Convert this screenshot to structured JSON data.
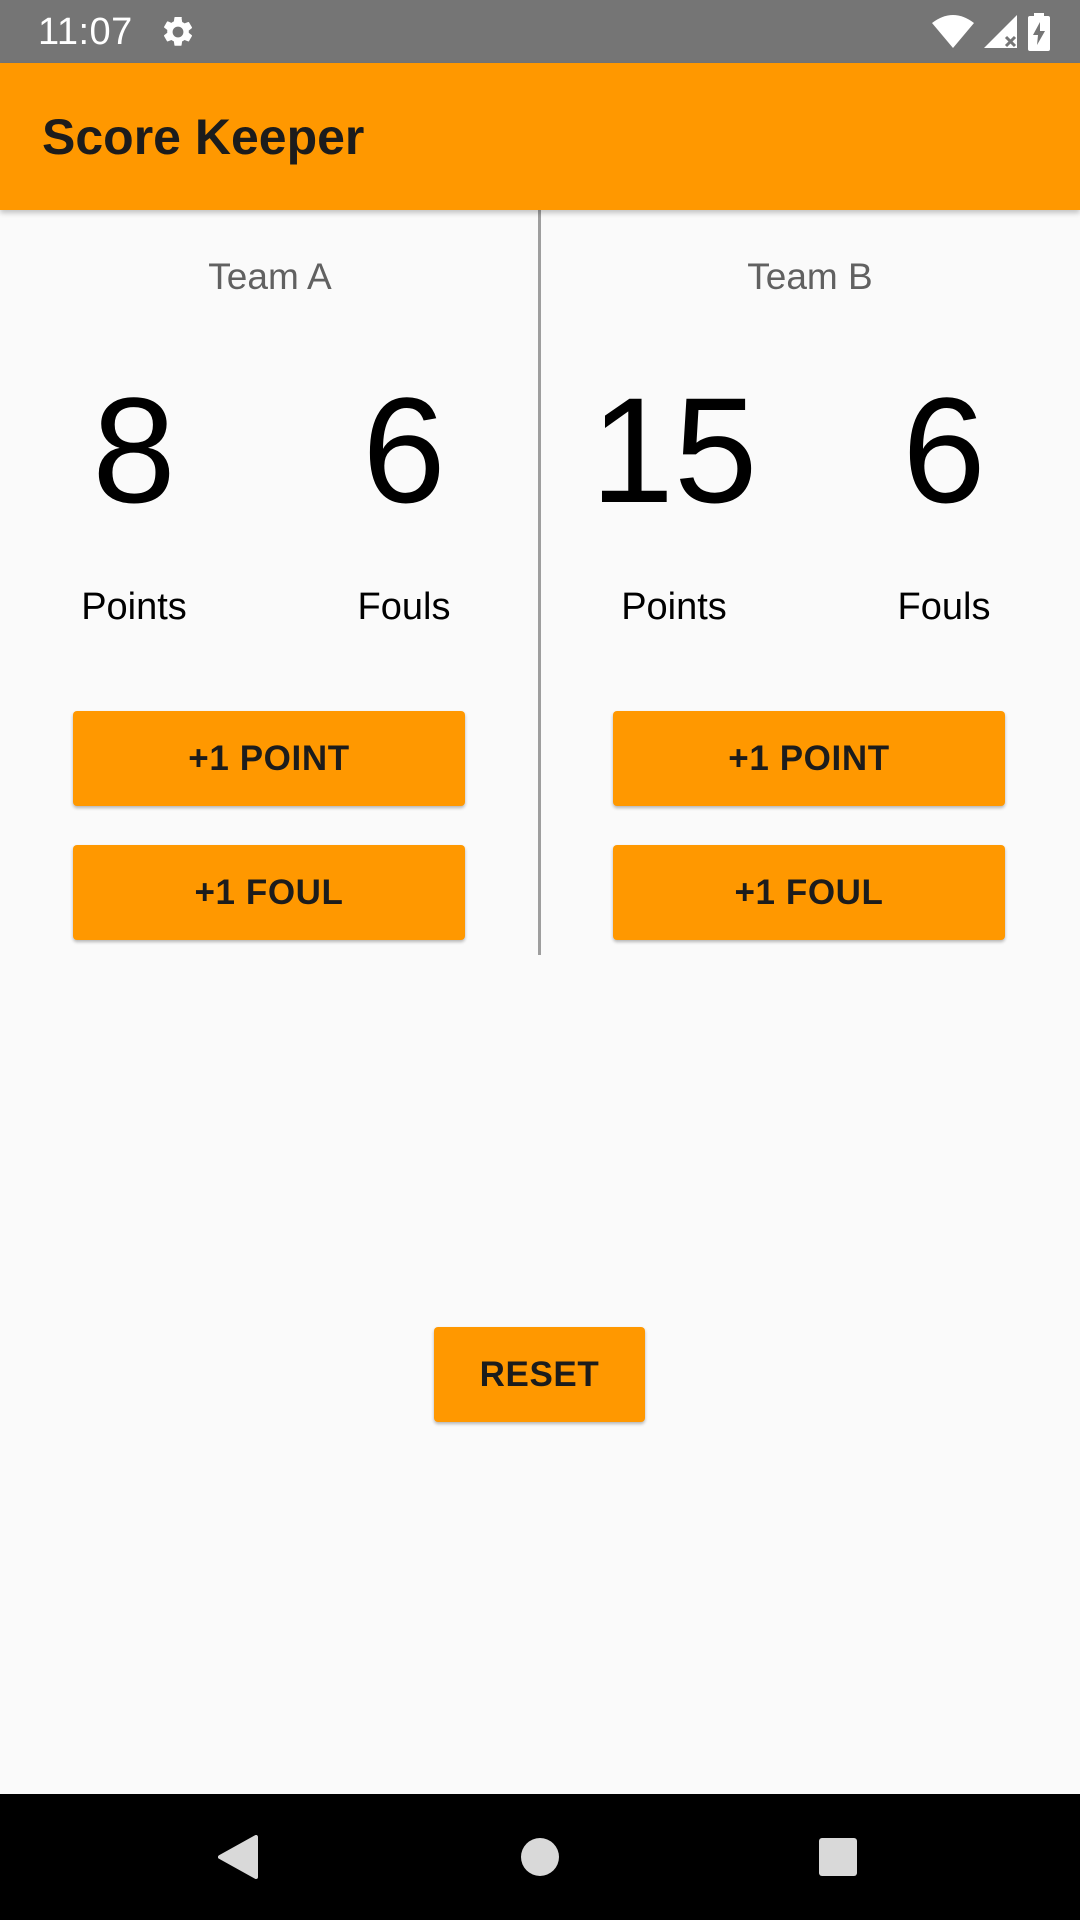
{
  "status_bar": {
    "time": "11:07",
    "icons": [
      "gear-icon",
      "wifi-icon",
      "cell-signal-icon",
      "battery-charging-icon"
    ]
  },
  "app_bar": {
    "title": "Score Keeper"
  },
  "team_a": {
    "name": "Team A",
    "points": "8",
    "fouls": "6",
    "points_label": "Points",
    "fouls_label": "Fouls",
    "add_point_label": "+1 POINT",
    "add_foul_label": "+1 FOUL"
  },
  "team_b": {
    "name": "Team B",
    "points": "15",
    "fouls": "6",
    "points_label": "Points",
    "fouls_label": "Fouls",
    "add_point_label": "+1 POINT",
    "add_foul_label": "+1 FOUL"
  },
  "reset_label": "RESET",
  "nav_bar": {
    "icons": [
      "back-icon",
      "home-icon",
      "recents-icon"
    ]
  },
  "colors": {
    "accent": "#ff9800",
    "status_bar": "#757575",
    "background": "#fafafa",
    "divider": "#9e9e9e"
  }
}
